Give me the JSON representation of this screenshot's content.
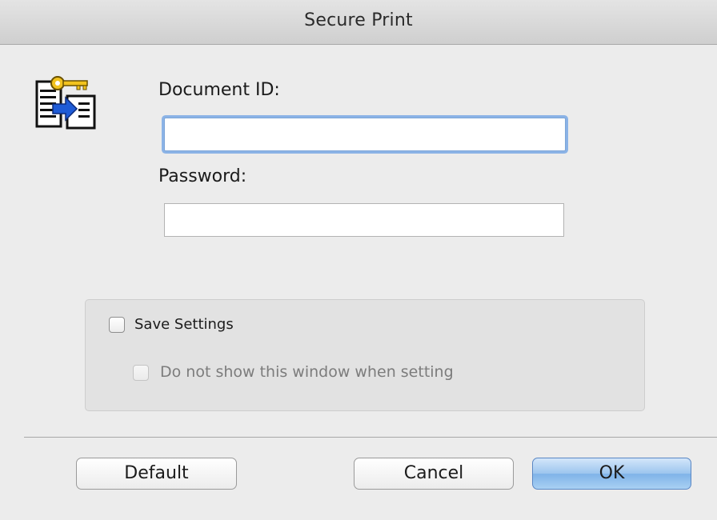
{
  "window": {
    "title": "Secure Print"
  },
  "icons": {
    "app": "secure-print-key-document-icon"
  },
  "form": {
    "document_id_label": "Document ID:",
    "document_id_value": "",
    "password_label": "Password:",
    "password_value": ""
  },
  "settings": {
    "save_settings_label": "Save Settings",
    "save_settings_checked": false,
    "do_not_show_label": "Do not show this window when setting",
    "do_not_show_checked": false,
    "do_not_show_enabled": false
  },
  "buttons": {
    "default_label": "Default",
    "cancel_label": "Cancel",
    "ok_label": "OK"
  },
  "colors": {
    "focus_ring": "#8bb3e6",
    "default_button_blue": "#7fb3e8"
  }
}
